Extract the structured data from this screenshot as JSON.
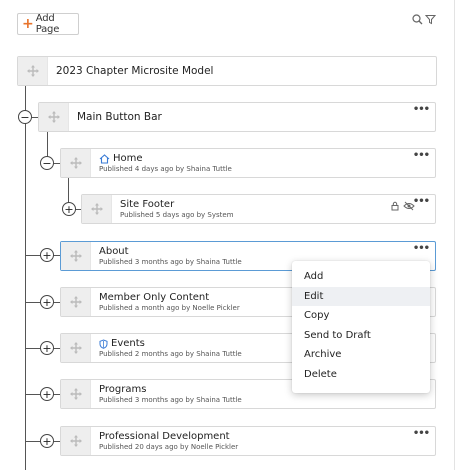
{
  "toolbar": {
    "add_page_label": "Add Page",
    "search_icon": "search-icon",
    "filter_icon": "filter-icon"
  },
  "tree": {
    "root": {
      "title": "2023 Chapter Microsite Model"
    },
    "main_button_bar": {
      "title": "Main Button Bar"
    },
    "home": {
      "title": "Home",
      "subtitle": "Published 4 days ago by Shaina Tuttle",
      "icon": "home-icon"
    },
    "site_footer": {
      "title": "Site Footer",
      "subtitle": "Published 5 days ago by System",
      "icons": [
        "lock-icon",
        "hidden-eye-icon"
      ]
    },
    "about": {
      "title": "About",
      "subtitle": "Published 3 months ago by Shaina Tuttle"
    },
    "member_only": {
      "title": "Member Only Content",
      "subtitle": "Published a month ago by Noelle Pickler"
    },
    "events": {
      "title": "Events",
      "subtitle": "Published 2 months ago by Shaina Tuttle",
      "icon": "shield-icon"
    },
    "programs": {
      "title": "Programs",
      "subtitle": "Published 3 months ago by Shaina Tuttle"
    },
    "professional_development": {
      "title": "Professional Development",
      "subtitle": "Published 20 days ago by Noelle Pickler"
    }
  },
  "context_menu": {
    "items": [
      "Add",
      "Edit",
      "Copy",
      "Send to Draft",
      "Archive",
      "Delete"
    ],
    "hovered": "Edit"
  },
  "colors": {
    "accent": "#e8742c",
    "selected_border": "#5b9bd5",
    "handle_bg": "#eeeeee"
  }
}
